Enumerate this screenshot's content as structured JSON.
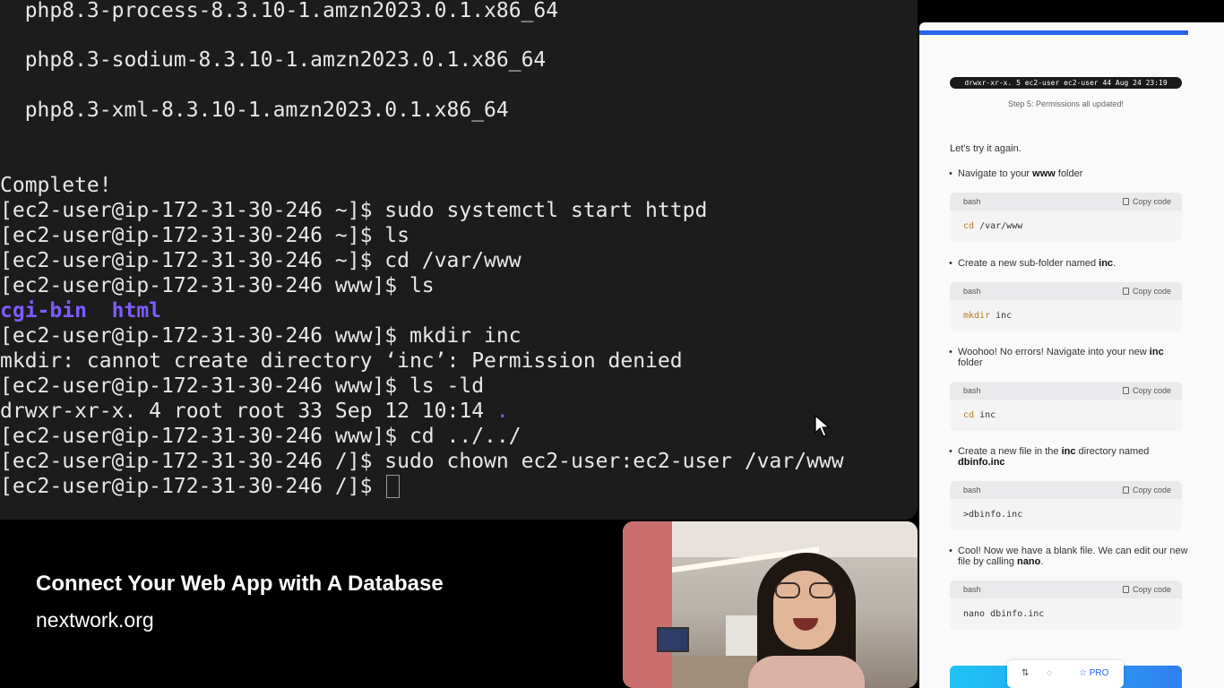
{
  "terminal": {
    "lines": [
      "  php8.3-process-8.3.10-1.amzn2023.0.1.x86_64",
      "  php8.3-sodium-8.3.10-1.amzn2023.0.1.x86_64",
      "  php8.3-xml-8.3.10-1.amzn2023.0.1.x86_64",
      "Complete!",
      "[ec2-user@ip-172-31-30-246 ~]$ sudo systemctl start httpd",
      "[ec2-user@ip-172-31-30-246 ~]$ ls",
      "[ec2-user@ip-172-31-30-246 ~]$ cd /var/www",
      "[ec2-user@ip-172-31-30-246 www]$ ls",
      "[ec2-user@ip-172-31-30-246 www]$ mkdir inc",
      "mkdir: cannot create directory ‘inc’: Permission denied",
      "[ec2-user@ip-172-31-30-246 www]$ ls -ld",
      "[ec2-user@ip-172-31-30-246 www]$ cd ../../",
      "[ec2-user@ip-172-31-30-246 /]$ sudo chown ec2-user:ec2-user /var/www",
      "[ec2-user@ip-172-31-30-246 /]$ "
    ],
    "dir_cgi": "cgi-bin",
    "dir_html": "html",
    "ls_ld_prefix": "drwxr-xr-x. 4 root root 33 Sep 12 10:14 ",
    "ls_ld_dot": "."
  },
  "overlay": {
    "title": "Connect Your Web App with A Database",
    "site": "nextwork.org"
  },
  "panel": {
    "perm_line": "drwxr-xr-x. 5 ec2-user ec2-user 44 Aug 24 23:19",
    "caption": "Step 5: Permissions all updated!",
    "intro": "Let's try it again.",
    "copy_label": "Copy code",
    "lang": "bash",
    "steps": [
      {
        "pre": "Navigate to your ",
        "bold": "www",
        "post": " folder",
        "kw": "cd",
        "rest": " /var/www"
      },
      {
        "pre": "Create a new sub-folder named ",
        "bold": "inc",
        "post": ".",
        "kw": "mkdir",
        "rest": " inc"
      },
      {
        "pre": "Woohoo! No errors! Navigate into your new ",
        "bold": "inc",
        "post": " folder",
        "kw": "cd",
        "rest": " inc"
      },
      {
        "pre": "Create a new file in the ",
        "bold": "inc",
        "mid": " directory named ",
        "bold2": "dbinfo.inc",
        "post": "",
        "kw": "",
        "rest": ">dbinfo.inc"
      },
      {
        "pre": "Cool! Now we have a blank file. We can edit our new file by calling ",
        "bold": "nano",
        "post": ".",
        "kw": "",
        "rest": "nano dbinfo.inc"
      }
    ],
    "bottom_pro": "☆ PRO"
  }
}
